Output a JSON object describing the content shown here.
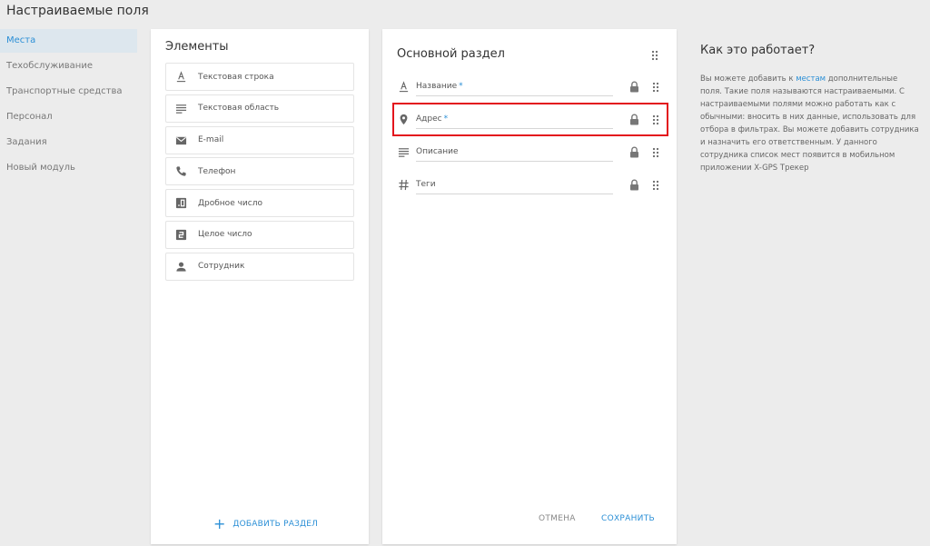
{
  "page": {
    "title": "Настраиваемые поля"
  },
  "sidebar": {
    "items": [
      {
        "label": "Места"
      },
      {
        "label": "Техобслуживание"
      },
      {
        "label": "Транспортные средства"
      },
      {
        "label": "Персонал"
      },
      {
        "label": "Задания"
      },
      {
        "label": "Новый модуль"
      }
    ]
  },
  "elements": {
    "heading": "Элементы",
    "items": [
      {
        "label": "Текстовая строка",
        "icon": "text-format-icon"
      },
      {
        "label": "Текстовая область",
        "icon": "text-area-icon"
      },
      {
        "label": "E-mail",
        "icon": "envelope-icon"
      },
      {
        "label": "Телефон",
        "icon": "phone-icon"
      },
      {
        "label": "Дробное число",
        "icon": "decimal-icon"
      },
      {
        "label": "Целое число",
        "icon": "integer-icon"
      },
      {
        "label": "Сотрудник",
        "icon": "person-icon"
      }
    ],
    "add_section": "ДОБАВИТЬ РАЗДЕЛ"
  },
  "section": {
    "heading": "Основной раздел",
    "fields": [
      {
        "label": "Название",
        "required": "*",
        "icon": "text-format-icon"
      },
      {
        "label": "Адрес",
        "required": "*",
        "icon": "map-pin-icon"
      },
      {
        "label": "Описание",
        "required": "",
        "icon": "text-area-icon"
      },
      {
        "label": "Теги",
        "required": "",
        "icon": "hash-icon"
      }
    ],
    "cancel": "ОТМЕНА",
    "save": "СОХРАНИТЬ"
  },
  "info": {
    "heading": "Как это работает?",
    "text_before": "Вы можете добавить к ",
    "link": "местам",
    "text_after": " дополнительные поля. Такие поля называются настраиваемыми. С настраиваемыми полями можно работать как с обычными: вносить в них данные, использовать для отбора в фильтрах. Вы можете добавить сотрудника и назначить его ответственным. У данного сотрудника список мест появится в мобильном приложении X-GPS Трекер"
  },
  "colors": {
    "accent": "#2b8fd6",
    "highlight": "#e3141d",
    "icon": "#666666",
    "active_bg": "#dde7ee"
  }
}
